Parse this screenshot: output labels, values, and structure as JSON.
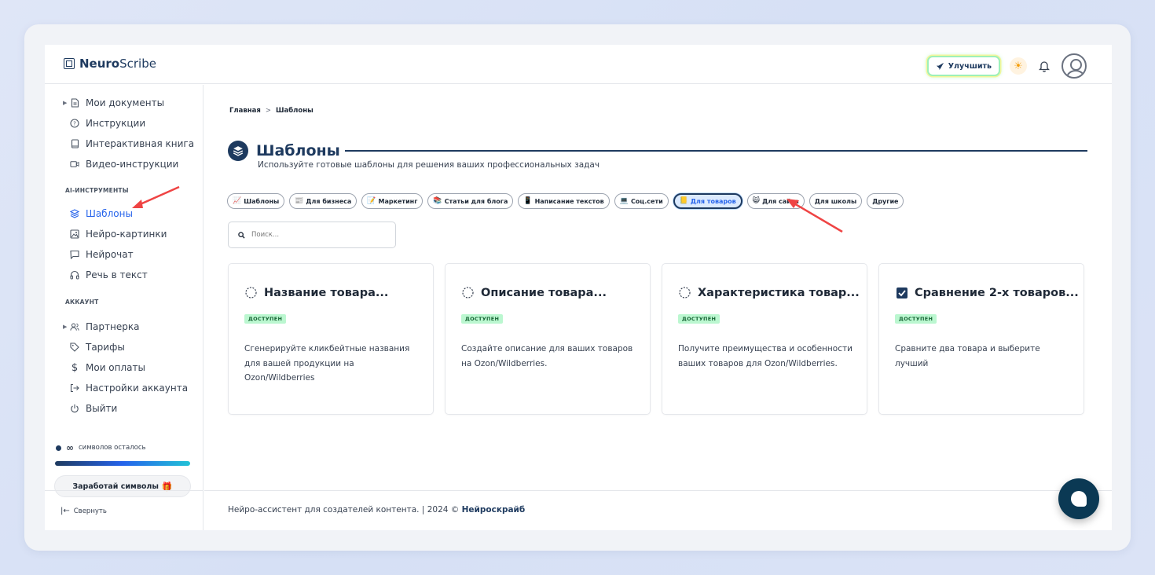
{
  "header": {
    "logo_bold": "Neuro",
    "logo_rest": "Scribe",
    "upgrade_label": "Улучшить"
  },
  "sidebar": {
    "items_top": [
      {
        "label": "Мои документы",
        "icon": "document-icon"
      },
      {
        "label": "Инструкции",
        "icon": "question-circle-icon"
      },
      {
        "label": "Интерактивная книга",
        "icon": "book-icon"
      },
      {
        "label": "Видео-инструкции",
        "icon": "video-icon"
      }
    ],
    "section_ai": "AI-ИНСТРУМЕНТЫ",
    "items_ai": [
      {
        "label": "Шаблоны",
        "icon": "layers-icon"
      },
      {
        "label": "Нейро-картинки",
        "icon": "image-icon"
      },
      {
        "label": "Нейрочат",
        "icon": "chat-icon"
      },
      {
        "label": "Речь в текст",
        "icon": "headphones-icon"
      }
    ],
    "section_account": "АККАУНТ",
    "items_account": [
      {
        "label": "Партнерка",
        "icon": "users-icon"
      },
      {
        "label": "Тарифы",
        "icon": "tag-icon"
      },
      {
        "label": "Мои оплаты",
        "icon": "dollar-icon"
      },
      {
        "label": "Настройки аккаунта",
        "icon": "login-icon"
      },
      {
        "label": "Выйти",
        "icon": "power-icon"
      }
    ],
    "usage_value": "∞",
    "usage_label": "символов осталось",
    "earn_label": "Заработай символы",
    "collapse_label": "Свернуть"
  },
  "main": {
    "breadcrumb_home": "Главная",
    "breadcrumb_sep": ">",
    "breadcrumb_current": "Шаблоны",
    "title": "Шаблоны",
    "subtitle": "Используйте готовые шаблоны для решения ваших профессиональных задач",
    "chips": [
      {
        "label": "Шаблоны",
        "icon": "📈",
        "active": false
      },
      {
        "label": "Для бизнеса",
        "icon": "📰",
        "active": false
      },
      {
        "label": "Маркетинг",
        "icon": "📝",
        "active": false
      },
      {
        "label": "Статьи для блога",
        "icon": "📚",
        "active": false
      },
      {
        "label": "Написание текстов",
        "icon": "📱",
        "active": false
      },
      {
        "label": "Соц.сети",
        "icon": "💻",
        "active": false
      },
      {
        "label": "Для товаров",
        "icon": "📒",
        "active": true
      },
      {
        "label": "Для сайта",
        "icon": "😸",
        "active": false
      },
      {
        "label": "Для школы",
        "icon": "",
        "active": false
      },
      {
        "label": "Другие",
        "icon": "",
        "active": false
      }
    ],
    "search_placeholder": "Поиск...",
    "cards": [
      {
        "title": "Название товара...",
        "badge": "ДОСТУПЕН",
        "desc": "Сгенерируйте кликбейтные названия для вашей продукции на Ozon/Wildberries",
        "icon": "dotted-circle-icon"
      },
      {
        "title": "Описание товара...",
        "badge": "ДОСТУПЕН",
        "desc": "Создайте описание для ваших товаров на Ozon/Wildberries.",
        "icon": "dotted-circle-icon"
      },
      {
        "title": "Характеристика товар...",
        "badge": "ДОСТУПЕН",
        "desc": "Получите преимущества и особенности ваших товаров для Ozon/Wildberries.",
        "icon": "dotted-circle-icon"
      },
      {
        "title": "Сравнение 2-х товаров...",
        "badge": "ДОСТУПЕН",
        "desc": "Сравните два товара и выберите лучший",
        "icon": "checkbox-icon"
      }
    ]
  },
  "footer": {
    "text": "Нейро-ассистент для создателей контента.  | 2024 © ",
    "link": "Нейроскрайб"
  },
  "colors": {
    "brand": "#1e3a5f",
    "accent": "#2563eb",
    "badge_bg": "#bbf7d0",
    "arrow": "#ef4444"
  }
}
